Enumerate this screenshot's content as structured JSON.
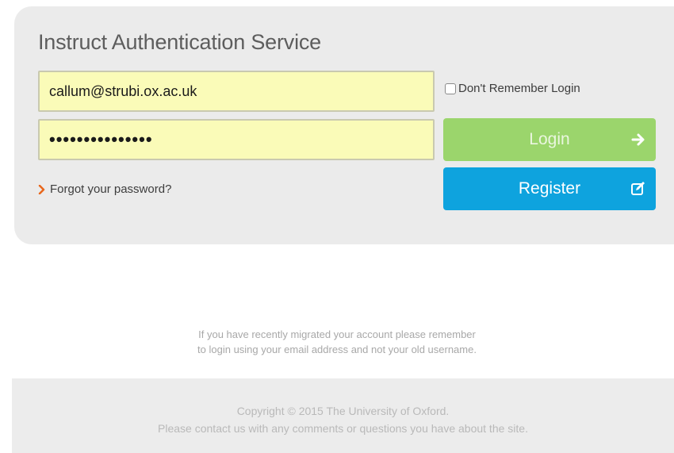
{
  "login": {
    "title": "Instruct Authentication Service",
    "email_value": "callum@strubi.ox.ac.uk",
    "password_value": "•••••••••••••••",
    "remember_label": "Don't Remember Login",
    "remember_checked": false,
    "login_label": "Login",
    "register_label": "Register",
    "forgot_label": "Forgot your password?"
  },
  "notice": {
    "line1": "If you have recently migrated your account please remember",
    "line2": "to login using your email address and not your old username."
  },
  "footer": {
    "copyright": "Copyright © 2015 The University of Oxford.",
    "contact": "Please contact us with any comments or questions you have about the site."
  },
  "colors": {
    "field_bg": "#fafbb8",
    "login_button": "#9bd56c",
    "register_button": "#0ea3de",
    "forgot_arrow": "#e8671c"
  },
  "icons": {
    "login": "arrow-right-icon",
    "register": "edit-icon",
    "forgot": "chevron-right-icon"
  }
}
